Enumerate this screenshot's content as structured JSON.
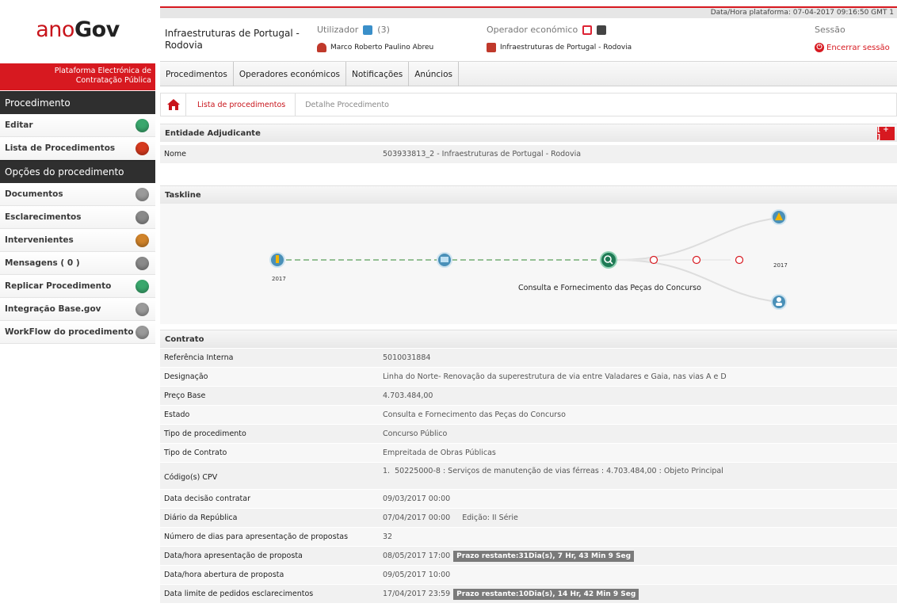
{
  "topbar": {
    "datetime": "Data/Hora plataforma: 07-04-2017 09:16:50 GMT 1"
  },
  "logo": {
    "part_a": "ano",
    "part_b": "Gov"
  },
  "sidebar": {
    "platform_banner_line1": "Plataforma Electrónica de",
    "platform_banner_line2": "Contratação Pública",
    "section_procedimento": "Procedimento",
    "procedimento_items": [
      {
        "label": "Editar",
        "icon": "edit-icon",
        "color": "#3aa76d"
      },
      {
        "label": "Lista de Procedimentos",
        "icon": "back-arrow-icon",
        "color": "#d53a1f"
      }
    ],
    "section_opcoes": "Opções do procedimento",
    "opcoes_items": [
      {
        "label": "Documentos",
        "icon": "documents-icon",
        "color": "#9a9a9a"
      },
      {
        "label": "Esclarecimentos",
        "icon": "info-icon",
        "color": "#8a8a8a"
      },
      {
        "label": "Intervenientes",
        "icon": "people-icon",
        "color": "#d0832a"
      },
      {
        "label": "Mensagens ( 0 )",
        "icon": "messages-icon",
        "color": "#8a8a8a"
      },
      {
        "label": "Replicar Procedimento",
        "icon": "replicate-icon",
        "color": "#3aa76d"
      },
      {
        "label": "Integração Base.gov",
        "icon": "megaphone-icon",
        "color": "#9a9a9a"
      },
      {
        "label": "WorkFlow do procedimento",
        "icon": "workflow-icon",
        "color": "#9a9a9a"
      }
    ]
  },
  "header": {
    "entity_title": "Infraestruturas de Portugal - Rodovia",
    "utilizador_label": "Utilizador",
    "utilizador_count": "(3)",
    "user_name": "Marco Roberto Paulino Abreu",
    "operador_label": "Operador económico",
    "operador_name": "Infraestruturas de Portugal - Rodovia",
    "sessao_label": "Sessão",
    "logout_label": "Encerrar sessão"
  },
  "nav": {
    "tabs": [
      "Procedimentos",
      "Operadores económicos",
      "Notificações",
      "Anúncios"
    ]
  },
  "breadcrumb": {
    "link": "Lista de procedimentos",
    "current": "Detalhe Procedimento"
  },
  "entidade": {
    "title": "Entidade Adjudicante",
    "toggle": "[ + ]",
    "nome_label": "Nome",
    "nome_value": "503933813_2 - Infraestruturas de Portugal - Rodovia"
  },
  "taskline": {
    "title": "Taskline",
    "start_year": "2017",
    "current_step": "Consulta e Fornecimento das Peças do Concurso",
    "end_year": "2017"
  },
  "contrato": {
    "title": "Contrato",
    "rows": [
      {
        "label": "Referência Interna",
        "value": "5010031884"
      },
      {
        "label": "Designação",
        "value": "Linha do Norte- Renovação da superestrutura de via entre Valadares e Gaia, nas vias A e D"
      },
      {
        "label": "Preço Base",
        "value": "4.703.484,00"
      },
      {
        "label": "Estado",
        "value": "Consulta e Fornecimento das Peças do Concurso"
      },
      {
        "label": "Tipo de procedimento",
        "value": "Concurso Público"
      },
      {
        "label": "Tipo de Contrato",
        "value": "Empreitada de Obras Públicas"
      },
      {
        "label": "Código(s) CPV",
        "value": "1.  50225000-8 : Serviços de manutenção de vias férreas : 4.703.484,00 : Objeto Principal"
      },
      {
        "label": "Data decisão contratar",
        "value": "09/03/2017 00:00"
      },
      {
        "label": "Diário da República",
        "value": "07/04/2017 00:00     Edição: II Série"
      },
      {
        "label": "Número de dias para apresentação de propostas",
        "value": "32"
      },
      {
        "label": "Data/hora apresentação de proposta",
        "value": "08/05/2017 17:00",
        "badge": "Prazo restante:31Dia(s), 7 Hr, 43 Min 9 Seg"
      },
      {
        "label": "Data/hora abertura de proposta",
        "value": "09/05/2017 10:00"
      },
      {
        "label": "Data limite de pedidos esclarecimentos",
        "value": "17/04/2017 23:59",
        "badge": "Prazo restante:10Dia(s), 14 Hr, 42 Min 9 Seg"
      }
    ]
  }
}
